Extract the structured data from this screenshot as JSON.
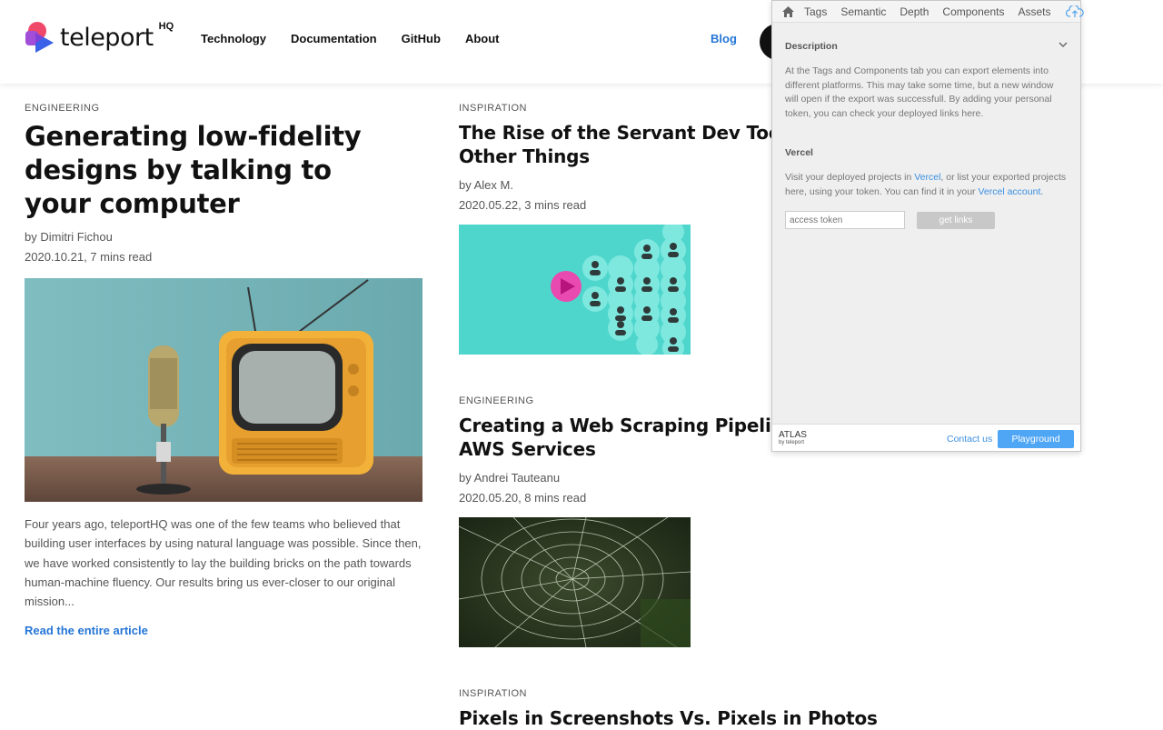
{
  "header": {
    "logo_text": "teleport",
    "logo_suffix": "HQ",
    "nav": [
      {
        "label": "Technology"
      },
      {
        "label": "Documentation"
      },
      {
        "label": "GitHub"
      },
      {
        "label": "About"
      }
    ],
    "blog_label": "Blog"
  },
  "articles": [
    {
      "category": "ENGINEERING",
      "title": "Generating low-fidelity designs by talking to your computer",
      "author": "by Dimitri Fichou",
      "date": "2020.10.21, 7 mins read",
      "image": "vintage-tv-and-microphone",
      "excerpt": "Four years ago, teleportHQ was one of the few teams who believed that building user interfaces by using natural language was possible. Since then, we have worked consistently to lay the building bricks on the path towards human-machine fluency. Our results bring us ever-closer to our original mission...",
      "read_more": "Read the entire article"
    },
    {
      "category": "INSPIRATION",
      "title": "The Rise of the Servant Dev Tools",
      "title_line2": "Other Things",
      "author": "by Alex M.",
      "date": "2020.05.22, 3 mins read",
      "image": "teal-user-bubbles-play"
    },
    {
      "category": "ENGINEERING",
      "title": "Creating a Web Scraping Pipeline",
      "title_line2": "AWS Services",
      "author": "by Andrei Tauteanu",
      "date": "2020.05.20, 8 mins read",
      "image": "spider-web-dew"
    },
    {
      "category": "INSPIRATION",
      "title": "Pixels in Screenshots Vs. Pixels in Photos"
    }
  ],
  "panel": {
    "tabs": [
      "Tags",
      "Semantic",
      "Depth",
      "Components",
      "Assets"
    ],
    "description_heading": "Description",
    "description_text": "At the Tags and Components tab you can export elements into different platforms. This may take some time, but a new window will open if the export was successfull. By adding your personal token, you can check your deployed links here.",
    "vercel_heading": "Vercel",
    "vercel_text_1": "Visit your deployed projects in ",
    "vercel_link_1": "Vercel",
    "vercel_text_2": ", or list your exported projects here, using your token. You can find it in your ",
    "vercel_link_2": "Vercel account",
    "vercel_text_3": ".",
    "token_placeholder": "access token",
    "get_links_label": "get links",
    "footer_brand": "ATLAS",
    "footer_brand_sub": "by teleport",
    "contact_label": "Contact us",
    "playground_label": "Playground"
  }
}
